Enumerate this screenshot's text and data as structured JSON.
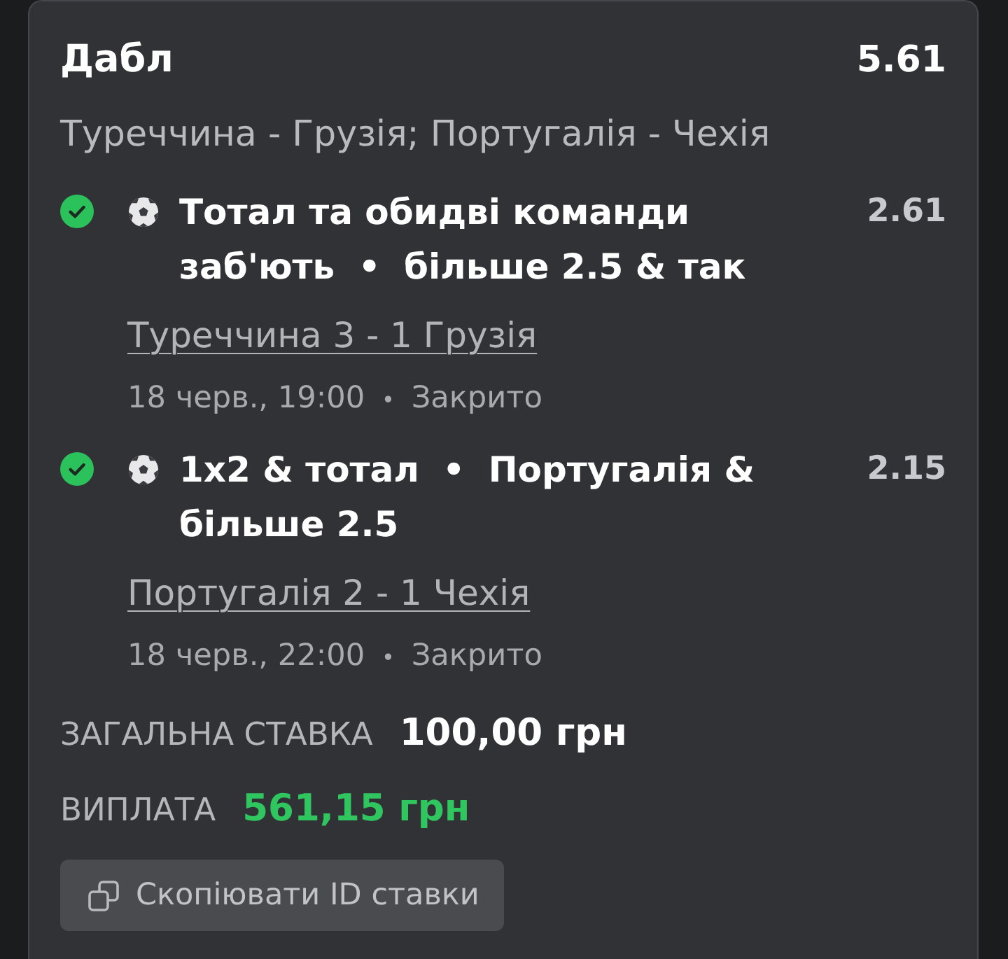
{
  "bet": {
    "type": "Дабл",
    "odds": "5.61",
    "events": "Туреччина - Грузія; Португалія - Чехія"
  },
  "selections": [
    {
      "won": true,
      "kind": "football",
      "bet_title": {
        "market": "Тотал та обидві команди заб'ють",
        "separator": "•",
        "pick": "більше 2.5 & так"
      },
      "odds": "2.61",
      "match": "Туреччина 3 - 1 Грузія",
      "schedule": {
        "date": "18 черв., 19:00",
        "separator": "•",
        "status": "Закрито"
      }
    },
    {
      "won": true,
      "kind": "football",
      "bet_title": {
        "market": "1x2 & тотал",
        "separator": "•",
        "pick": "Португалія & більше 2.5"
      },
      "odds": "2.15",
      "match": "Португалія 2 - 1 Чехія",
      "schedule": {
        "date": "18 черв., 22:00",
        "separator": "•",
        "status": "Закрито"
      }
    }
  ],
  "totals": [
    {
      "kind": "stake",
      "label": "ЗАГАЛЬНА СТАВКА",
      "value": "100,00 грн"
    },
    {
      "kind": "payout",
      "label": "ВИПЛАТА",
      "value": "561,15 грн"
    }
  ],
  "copy_button": {
    "label": "Скопіювати ID ставки"
  }
}
